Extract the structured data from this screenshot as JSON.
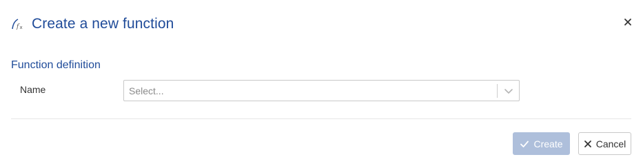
{
  "dialog": {
    "title": "Create a new function",
    "icon": "function-fx-icon",
    "close_icon": "close-icon"
  },
  "section": {
    "title": "Function definition"
  },
  "fields": {
    "name": {
      "label": "Name",
      "placeholder": "Select...",
      "value": ""
    }
  },
  "footer": {
    "create_label": "Create",
    "cancel_label": "Cancel",
    "create_disabled": true
  },
  "colors": {
    "accent": "#1f4b99",
    "create_disabled_bg": "#aebfdb"
  }
}
